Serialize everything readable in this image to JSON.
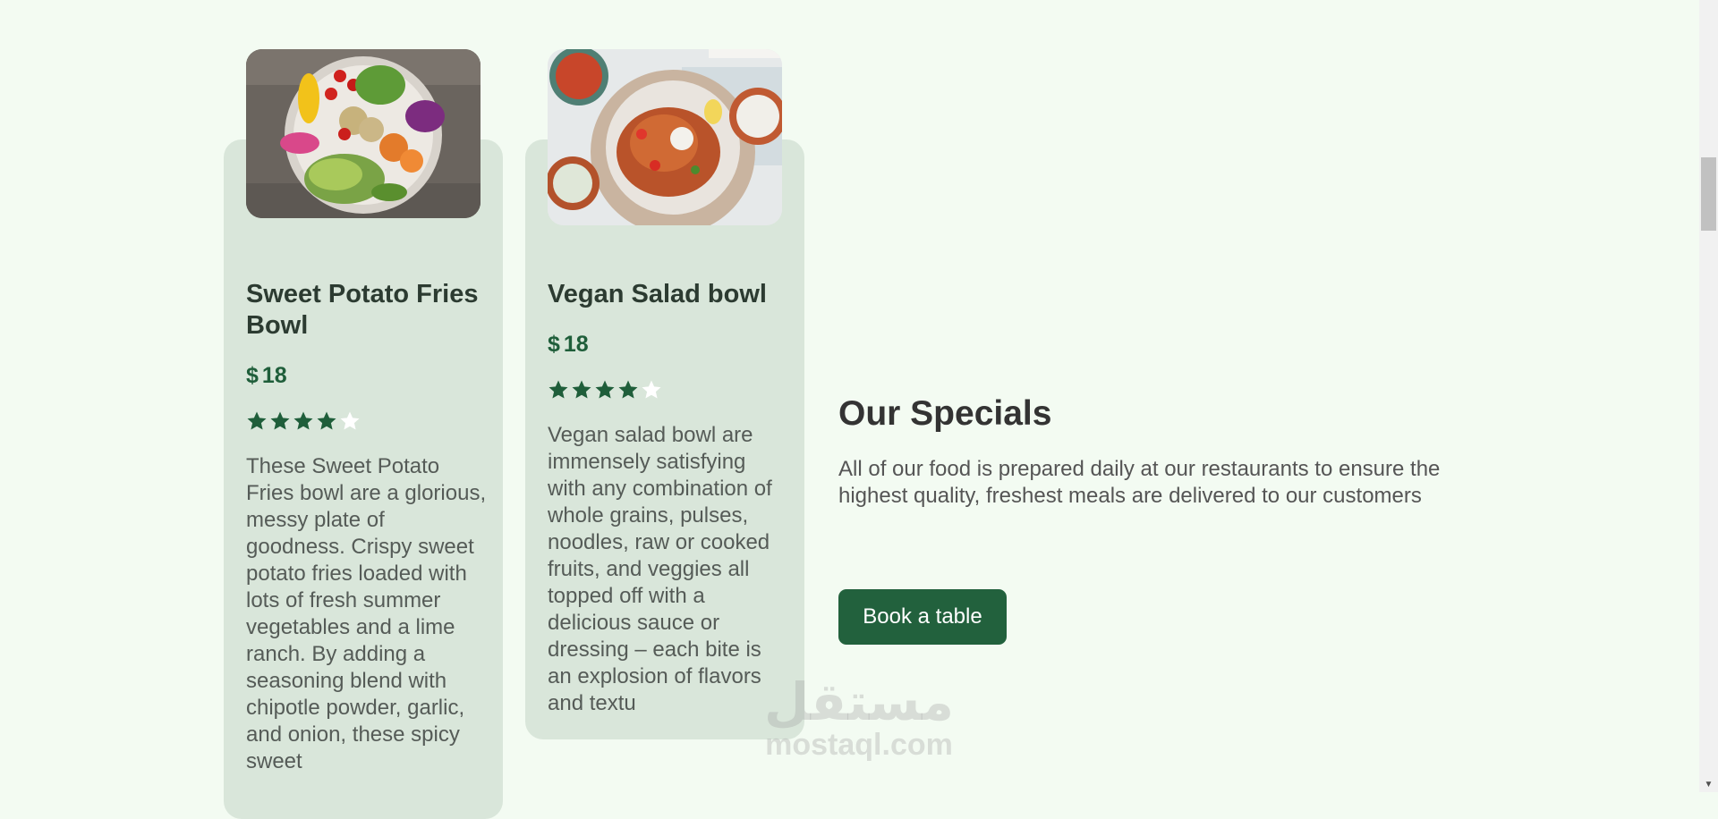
{
  "cards": [
    {
      "title": "Sweet Potato Fries Bowl",
      "currency": "$",
      "price": "18",
      "rating": 4,
      "max_rating": 5,
      "description": "These Sweet Potato Fries bowl are a glorious, messy plate of goodness. Crispy sweet potato fries loaded with lots of fresh summer vegetables and a lime ranch. By adding a seasoning blend with chipotle powder, garlic, and onion, these spicy sweet"
    },
    {
      "title": "Vegan Salad bowl",
      "currency": "$",
      "price": "18",
      "rating": 4,
      "max_rating": 5,
      "description": "Vegan salad bowl are immensely satisfying with any combination of whole grains, pulses, noodles, raw or cooked fruits, and veggies all topped off with a delicious sauce or dressing – each bite is an explosion of flavors and textu"
    }
  ],
  "specials": {
    "heading": "Our Specials",
    "text": "All of our food is prepared daily at our restaurants to ensure the highest quality, freshest meals are delivered to our customers",
    "button_label": "Book a table"
  },
  "watermark": {
    "arabic": "مستقل",
    "latin": "mostaql.com"
  },
  "colors": {
    "background": "#f3fbf2",
    "card": "#d9e6da",
    "accent": "#22613d",
    "star_filled": "#1f5e3a",
    "star_empty": "#ffffff"
  },
  "icons": {
    "star": "star-icon"
  }
}
